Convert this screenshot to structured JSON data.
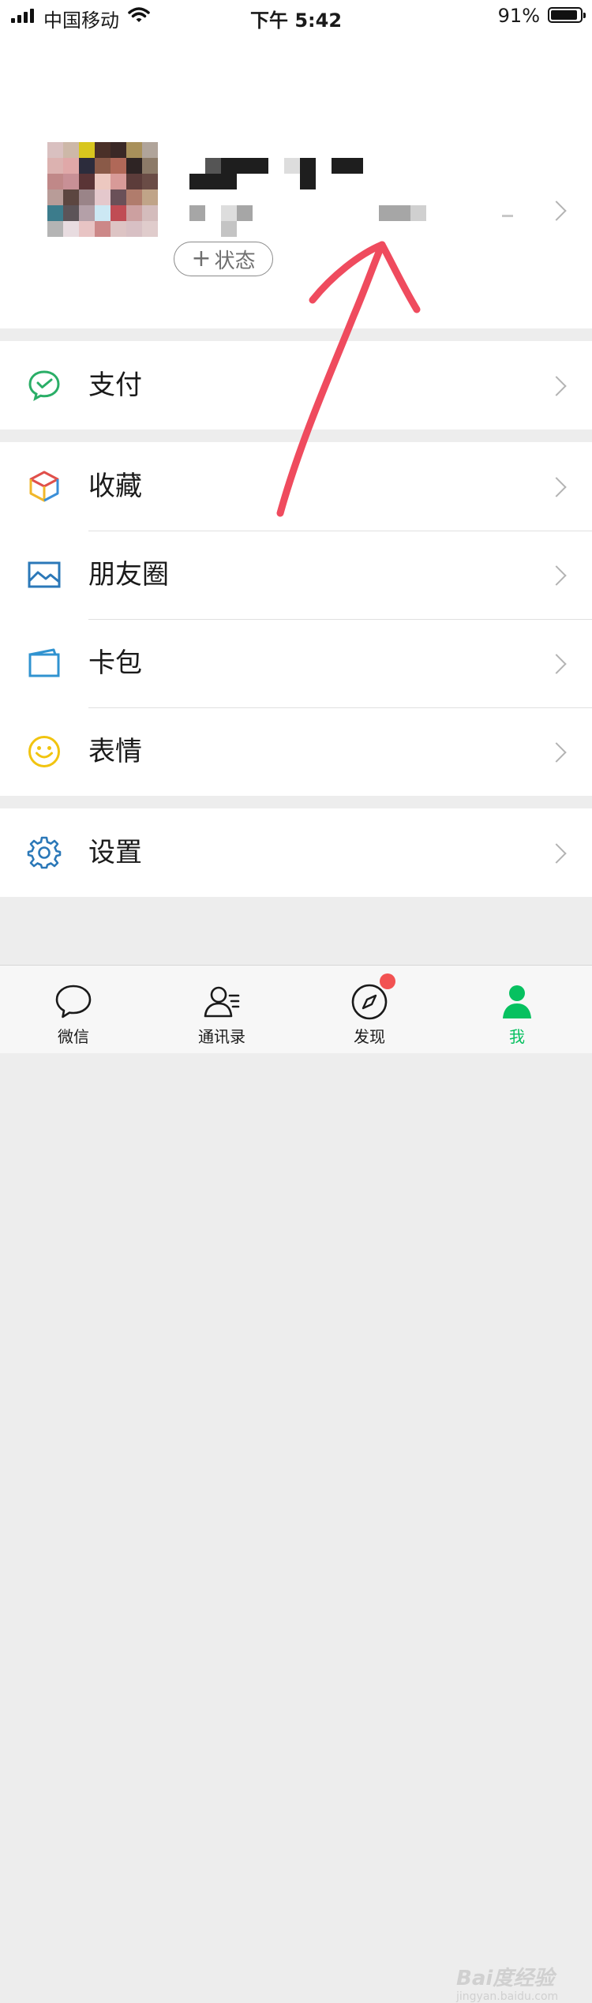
{
  "status_bar": {
    "carrier": "中国移动",
    "time": "下午 5:42",
    "battery_percent": "91%",
    "battery_level": 0.91
  },
  "profile": {
    "status_button_plus": "+",
    "status_button_label": "状态"
  },
  "menu": {
    "pay": {
      "label": "支付",
      "icon": "wechat-pay-icon"
    },
    "favorites": {
      "label": "收藏",
      "icon": "cube-icon"
    },
    "moments": {
      "label": "朋友圈",
      "icon": "picture-icon"
    },
    "cards": {
      "label": "卡包",
      "icon": "card-icon"
    },
    "stickers": {
      "label": "表情",
      "icon": "smiley-icon"
    },
    "settings": {
      "label": "设置",
      "icon": "gear-icon"
    }
  },
  "tabbar": {
    "chats": {
      "label": "微信",
      "icon": "chat-bubble-icon"
    },
    "contacts": {
      "label": "通讯录",
      "icon": "contacts-icon"
    },
    "discover": {
      "label": "发现",
      "icon": "compass-icon"
    },
    "me": {
      "label": "我",
      "icon": "person-icon"
    }
  },
  "watermark": {
    "main": "Bai度经验",
    "sub": "jingyan.baidu.com"
  },
  "colors": {
    "accent_green": "#07c160",
    "pay_green": "#2aae67",
    "link_blue": "#2b78b8",
    "badge_red": "#f25252",
    "annotation_red": "#ef4b5e"
  }
}
